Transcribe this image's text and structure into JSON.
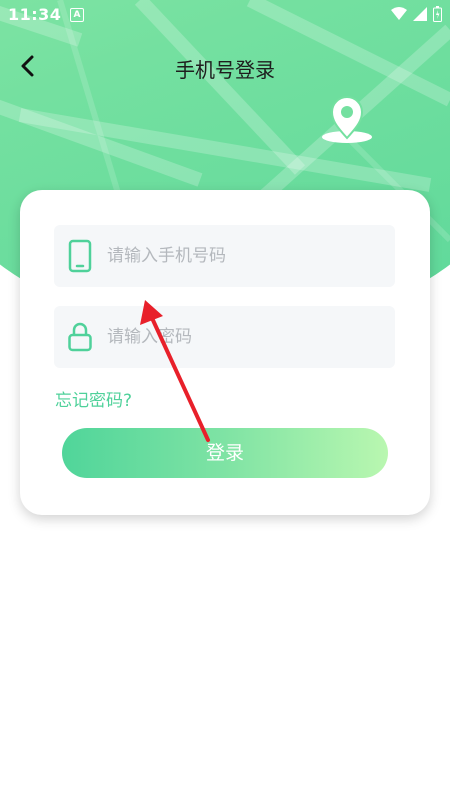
{
  "status_bar": {
    "time": "11:34",
    "notification_icon": "a-icon",
    "icons": [
      "wifi-icon",
      "signal-icon",
      "battery-icon"
    ]
  },
  "header": {
    "title": "手机号登录",
    "back_icon": "back-icon",
    "decor_icon": "location-pin-icon"
  },
  "form": {
    "phone": {
      "placeholder": "请输入手机号码",
      "value": "",
      "icon": "phone-icon"
    },
    "password": {
      "placeholder": "请输入密码",
      "value": "",
      "icon": "lock-icon"
    },
    "forgot_label": "忘记密码?",
    "login_label": "登录"
  },
  "colors": {
    "accent": "#4fd19a",
    "header_green": "#74e0a0",
    "annotation_arrow": "#e8202a"
  }
}
